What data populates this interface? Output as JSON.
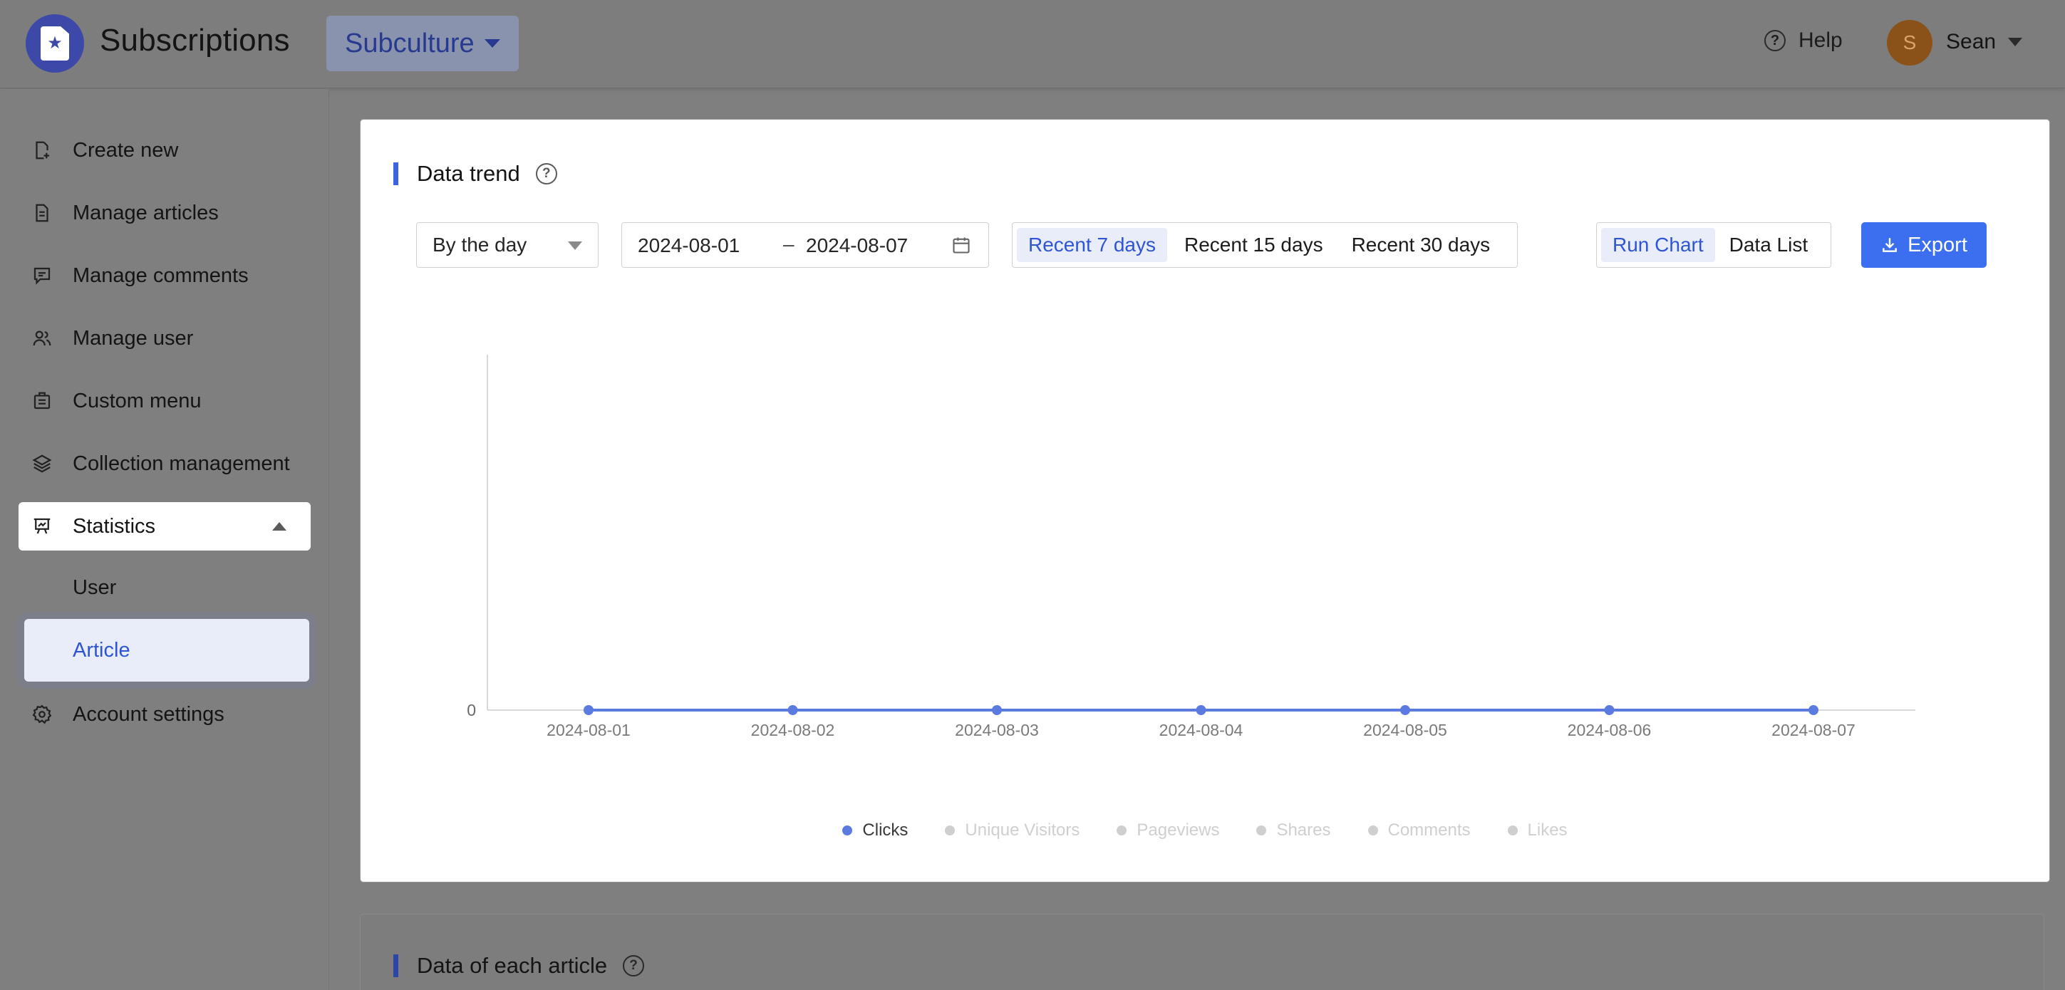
{
  "app": {
    "title": "Subscriptions",
    "workspace": "Subculture",
    "help_label": "Help",
    "user": {
      "name": "Sean",
      "initial": "S"
    }
  },
  "sidebar": {
    "items": [
      {
        "label": "Create new",
        "icon": "create-new-icon"
      },
      {
        "label": "Manage articles",
        "icon": "article-icon"
      },
      {
        "label": "Manage comments",
        "icon": "comment-icon"
      },
      {
        "label": "Manage user",
        "icon": "users-icon"
      },
      {
        "label": "Custom menu",
        "icon": "menu-icon"
      },
      {
        "label": "Collection management",
        "icon": "layers-icon"
      }
    ],
    "statistics": {
      "label": "Statistics",
      "icon": "statistics-icon",
      "expanded": true,
      "children": [
        {
          "label": "User",
          "active": false
        },
        {
          "label": "Article",
          "active": true
        }
      ]
    },
    "account_settings": {
      "label": "Account settings",
      "icon": "gear-icon"
    }
  },
  "trend_card": {
    "title": "Data trend",
    "granularity": "By the day",
    "date_start": "2024-08-01",
    "date_separator": "–",
    "date_end": "2024-08-07",
    "presets": [
      {
        "label": "Recent 7 days",
        "active": true
      },
      {
        "label": "Recent 15 days",
        "active": false
      },
      {
        "label": "Recent 30 days",
        "active": false
      }
    ],
    "views": [
      {
        "label": "Run Chart",
        "active": true
      },
      {
        "label": "Data List",
        "active": false
      }
    ],
    "export_label": "Export"
  },
  "chart_data": {
    "type": "line",
    "x": [
      "2024-08-01",
      "2024-08-02",
      "2024-08-03",
      "2024-08-04",
      "2024-08-05",
      "2024-08-06",
      "2024-08-07"
    ],
    "y_ticks": [
      "0"
    ],
    "series": [
      {
        "name": "Clicks",
        "values": [
          0,
          0,
          0,
          0,
          0,
          0,
          0
        ],
        "color": "#5b7be0",
        "visible": true
      },
      {
        "name": "Unique Visitors",
        "values": [],
        "color": "#cfcfcf",
        "visible": false
      },
      {
        "name": "Pageviews",
        "values": [],
        "color": "#cfcfcf",
        "visible": false
      },
      {
        "name": "Shares",
        "values": [],
        "color": "#cfcfcf",
        "visible": false
      },
      {
        "name": "Comments",
        "values": [],
        "color": "#cfcfcf",
        "visible": false
      },
      {
        "name": "Likes",
        "values": [],
        "color": "#cfcfcf",
        "visible": false
      }
    ],
    "legend_position": "bottom",
    "grid": false
  },
  "article_card": {
    "title": "Data of each article"
  },
  "colors": {
    "accent": "#3c6ef0",
    "accent_text": "#2f55d4",
    "active_bg": "#e8edf9",
    "legend_inactive": "#cfcfcf"
  }
}
